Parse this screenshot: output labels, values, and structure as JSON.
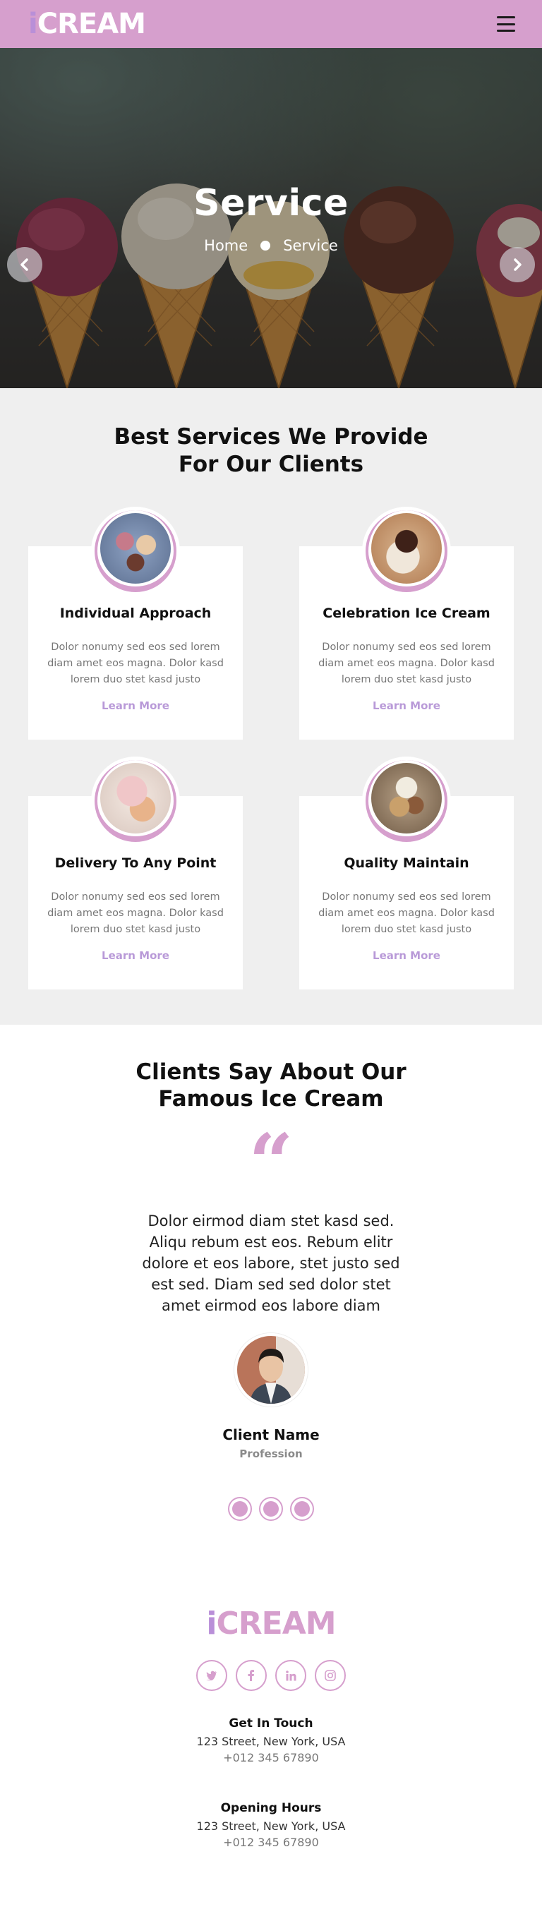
{
  "nav": {
    "brand_prefix": "i",
    "brand_rest": "CREAM",
    "menu_icon": "hamburger-icon"
  },
  "hero": {
    "title": "Service",
    "breadcrumb": [
      "Home",
      "Service"
    ],
    "prev_icon": "chevron-left-icon",
    "next_icon": "chevron-right-icon"
  },
  "services": {
    "heading_line1": "Best Services We Provide",
    "heading_line2": "For Our Clients",
    "items": [
      {
        "title": "Individual Approach",
        "text": "Dolor nonumy sed eos sed lorem diam amet eos magna. Dolor kasd lorem duo stet kasd justo",
        "link": "Learn More"
      },
      {
        "title": "Celebration Ice Cream",
        "text": "Dolor nonumy sed eos sed lorem diam amet eos magna. Dolor kasd lorem duo stet kasd justo",
        "link": "Learn More"
      },
      {
        "title": "Delivery To Any Point",
        "text": "Dolor nonumy sed eos sed lorem diam amet eos magna. Dolor kasd lorem duo stet kasd justo",
        "link": "Learn More"
      },
      {
        "title": "Quality Maintain",
        "text": "Dolor nonumy sed eos sed lorem diam amet eos magna. Dolor kasd lorem duo stet kasd justo",
        "link": "Learn More"
      }
    ]
  },
  "testimonial": {
    "heading_line1": "Clients Say About Our",
    "heading_line2": "Famous Ice Cream",
    "quote": "Dolor eirmod diam stet kasd sed. Aliqu rebum est eos. Rebum elitr dolore et eos labore, stet justo sed est sed. Diam sed sed dolor stet amet eirmod eos labore diam",
    "client_name": "Client Name",
    "client_profession": "Profession"
  },
  "footer": {
    "brand_prefix": "i",
    "brand_rest": "CREAM",
    "social": [
      "twitter-icon",
      "facebook-icon",
      "linkedin-icon",
      "instagram-icon"
    ],
    "get_in_touch": {
      "heading": "Get In Touch",
      "address": "123 Street, New York, USA",
      "phone": "+012 345 67890"
    },
    "opening_hours": {
      "heading": "Opening Hours",
      "address": "123 Street, New York, USA",
      "phone": "+012 345 67890"
    }
  },
  "colors": {
    "accent": "#D69FCD",
    "accent_secondary": "#B99AD8",
    "section_bg": "#EFEFEF"
  }
}
